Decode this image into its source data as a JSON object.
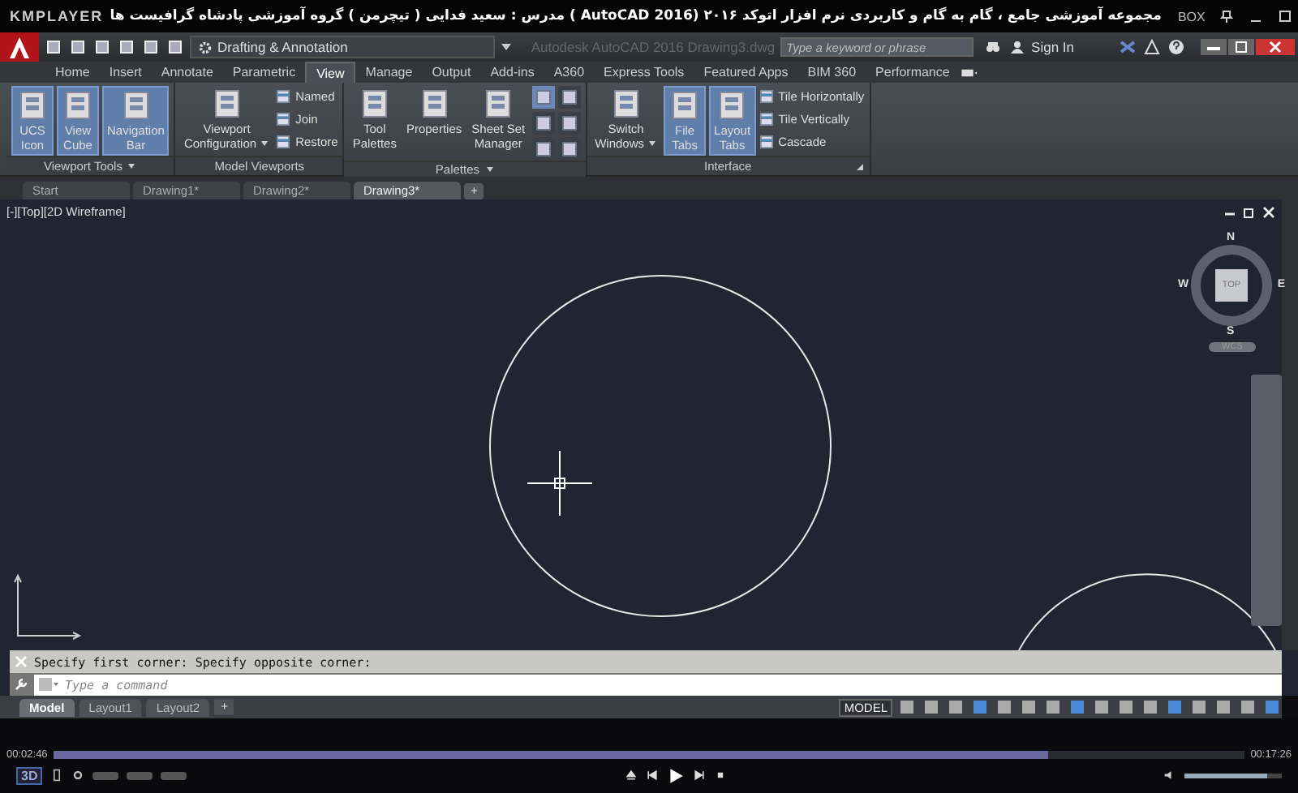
{
  "player": {
    "name": "KMPLAYER",
    "title": "مجموعه آموزشی جامع ، گام به گام و کاربردی نرم افزار  اتوکد ۲۰۱۶ (2016 AutoCAD )  مدرس : سعید فدایی ( تیچرمن ) گروه آموزشی پادشاه گرافیست ها",
    "box": "BOX",
    "badge": "3D",
    "time_elapsed": "00:02:46",
    "time_total": "00:17:26",
    "progress": {
      "level": 0.836
    },
    "volume": {
      "level": 0.85
    }
  },
  "app": {
    "workspace": "Drafting & Annotation",
    "title": "Autodesk AutoCAD 2016    Drawing3.dwg",
    "search": {
      "placeholder": "Type a keyword or phrase"
    },
    "sign_in": "Sign In"
  },
  "ribbon_tabs": [
    {
      "label": "Home",
      "selected": false
    },
    {
      "label": "Insert",
      "selected": false
    },
    {
      "label": "Annotate",
      "selected": false
    },
    {
      "label": "Parametric",
      "selected": false
    },
    {
      "label": "View",
      "selected": true
    },
    {
      "label": "Manage",
      "selected": false
    },
    {
      "label": "Output",
      "selected": false
    },
    {
      "label": "Add-ins",
      "selected": false
    },
    {
      "label": "A360",
      "selected": false
    },
    {
      "label": "Express Tools",
      "selected": false
    },
    {
      "label": "Featured Apps",
      "selected": false
    },
    {
      "label": "BIM 360",
      "selected": false
    },
    {
      "label": "Performance",
      "selected": false
    }
  ],
  "ribbon_panels": [
    {
      "title": "Viewport Tools",
      "dropdown": true,
      "launcher": false,
      "items": [
        {
          "kind": "large",
          "lines": [
            "UCS",
            "Icon"
          ],
          "on": true,
          "menu": false
        },
        {
          "kind": "large",
          "lines": [
            "View",
            "Cube"
          ],
          "on": true,
          "menu": false
        },
        {
          "kind": "large",
          "lines": [
            "Navigation",
            "Bar"
          ],
          "on": true,
          "menu": false
        }
      ]
    },
    {
      "title": "Model Viewports",
      "dropdown": false,
      "launcher": false,
      "items": [
        {
          "kind": "large",
          "lines": [
            "Viewport",
            "Configuration"
          ],
          "on": false,
          "menu": true
        },
        {
          "kind": "stack",
          "rows": [
            {
              "label": "Named"
            },
            {
              "label": "Join"
            },
            {
              "label": "Restore"
            }
          ]
        }
      ]
    },
    {
      "title": "Palettes",
      "dropdown": true,
      "launcher": false,
      "items": [
        {
          "kind": "large",
          "lines": [
            "Tool",
            "Palettes"
          ],
          "on": false,
          "menu": false
        },
        {
          "kind": "large",
          "lines": [
            "Properties"
          ],
          "on": false,
          "menu": false
        },
        {
          "kind": "large",
          "lines": [
            "Sheet Set",
            "Manager"
          ],
          "on": false,
          "menu": false
        },
        {
          "kind": "grid",
          "icons": [
            {
              "on": true
            },
            {
              "on": false
            },
            {
              "on": false
            },
            {
              "on": false
            },
            {
              "on": false
            },
            {
              "on": false
            }
          ]
        }
      ]
    },
    {
      "title": "Interface",
      "dropdown": false,
      "launcher": true,
      "items": [
        {
          "kind": "large",
          "lines": [
            "Switch",
            "Windows"
          ],
          "on": false,
          "menu": true
        },
        {
          "kind": "large",
          "lines": [
            "File",
            "Tabs"
          ],
          "on": true,
          "menu": false
        },
        {
          "kind": "large",
          "lines": [
            "Layout",
            "Tabs"
          ],
          "on": true,
          "menu": false
        },
        {
          "kind": "stack",
          "rows": [
            {
              "label": "Tile Horizontally"
            },
            {
              "label": "Tile Vertically"
            },
            {
              "label": "Cascade"
            }
          ]
        }
      ]
    }
  ],
  "file_tabs": [
    {
      "label": "Start",
      "selected": false
    },
    {
      "label": "Drawing1*",
      "selected": false
    },
    {
      "label": "Drawing2*",
      "selected": false
    },
    {
      "label": "Drawing3*",
      "selected": true
    }
  ],
  "new_tab": "+",
  "viewport": {
    "label": "[-][Top][2D Wireframe]",
    "viewcube": {
      "north": "N",
      "south": "S",
      "east": "E",
      "west": "W",
      "face": "TOP",
      "ucs": "WCS"
    }
  },
  "command": {
    "history": "Specify first corner: Specify opposite corner:",
    "placeholder": "Type a command"
  },
  "layout_tabs": [
    {
      "label": "Model",
      "selected": true
    },
    {
      "label": "Layout1",
      "selected": false
    },
    {
      "label": "Layout2",
      "selected": false
    }
  ],
  "new_layout": "+",
  "status_bar": {
    "mode": "MODEL"
  }
}
